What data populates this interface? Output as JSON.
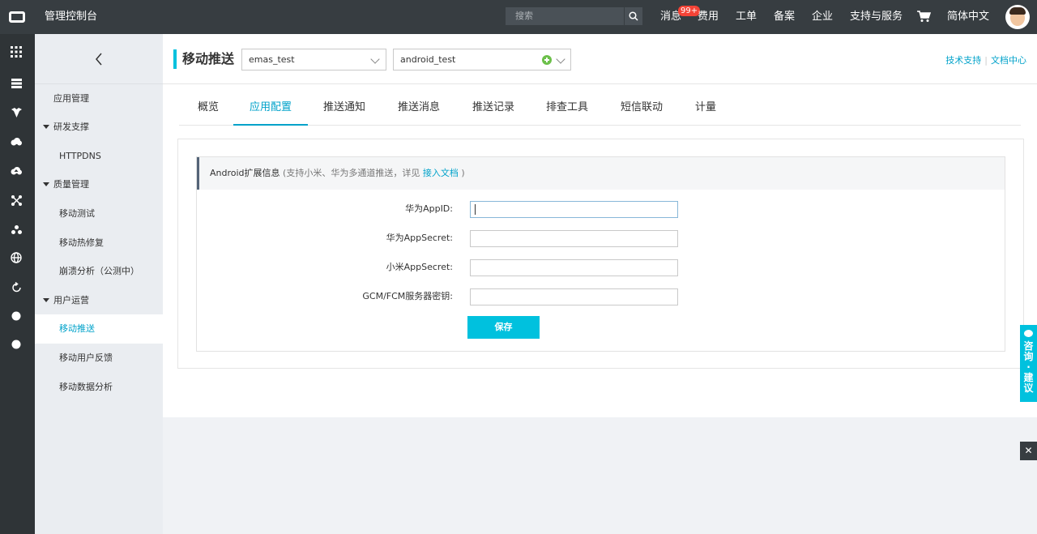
{
  "topbar": {
    "console_title": "管理控制台",
    "search_placeholder": "搜索",
    "nav": {
      "messages": "消息",
      "messages_badge": "99+",
      "billing": "费用",
      "tickets": "工单",
      "icp": "备案",
      "enterprise": "企业",
      "support": "支持与服务",
      "language": "简体中文"
    }
  },
  "rail": {
    "icons": [
      "grid-icon",
      "list-icon",
      "shield-icon",
      "cloud-icon",
      "cloud-up-icon",
      "cross-nodes-icon",
      "cluster-icon",
      "globe-icon",
      "refresh-icon",
      "dot-icon",
      "dot-icon"
    ]
  },
  "sidebar": {
    "collapse_glyph": "‹",
    "app_management": "应用管理",
    "groups": [
      {
        "label": "研发支撑",
        "items": [
          "HTTPDNS"
        ]
      },
      {
        "label": "质量管理",
        "items": [
          "移动测试",
          "移动热修复",
          "崩溃分析（公测中）"
        ]
      },
      {
        "label": "用户运营",
        "items": [
          "移动推送",
          "移动用户反馈",
          "移动数据分析"
        ]
      }
    ],
    "active_item": "移动推送"
  },
  "header": {
    "title": "移动推送",
    "project_select": "emas_test",
    "app_select": "android_test",
    "links": {
      "tech_support": "技术支持",
      "separator": "|",
      "docs": "文档中心"
    }
  },
  "tabs": [
    {
      "label": "概览"
    },
    {
      "label": "应用配置"
    },
    {
      "label": "推送通知"
    },
    {
      "label": "推送消息"
    },
    {
      "label": "推送记录"
    },
    {
      "label": "排查工具"
    },
    {
      "label": "短信联动"
    },
    {
      "label": "计量"
    }
  ],
  "active_tab": "应用配置",
  "panel": {
    "heading": "Android扩展信息",
    "note_prefix": " (支持小米、华为多通道推送，详见 ",
    "note_link": "接入文档",
    "note_suffix": " )",
    "fields": [
      {
        "label": "华为AppID:",
        "value": ""
      },
      {
        "label": "华为AppSecret:",
        "value": ""
      },
      {
        "label": "小米AppSecret:",
        "value": ""
      },
      {
        "label": "GCM/FCM服务器密钥:",
        "value": ""
      }
    ],
    "save_label": "保存"
  },
  "floating": {
    "consult_label": "咨询·建议",
    "close_glyph": "✕"
  },
  "colors": {
    "topbar": "#373d41",
    "accent": "#00c1de",
    "link": "#00a2ca",
    "badge": "#f44336"
  }
}
